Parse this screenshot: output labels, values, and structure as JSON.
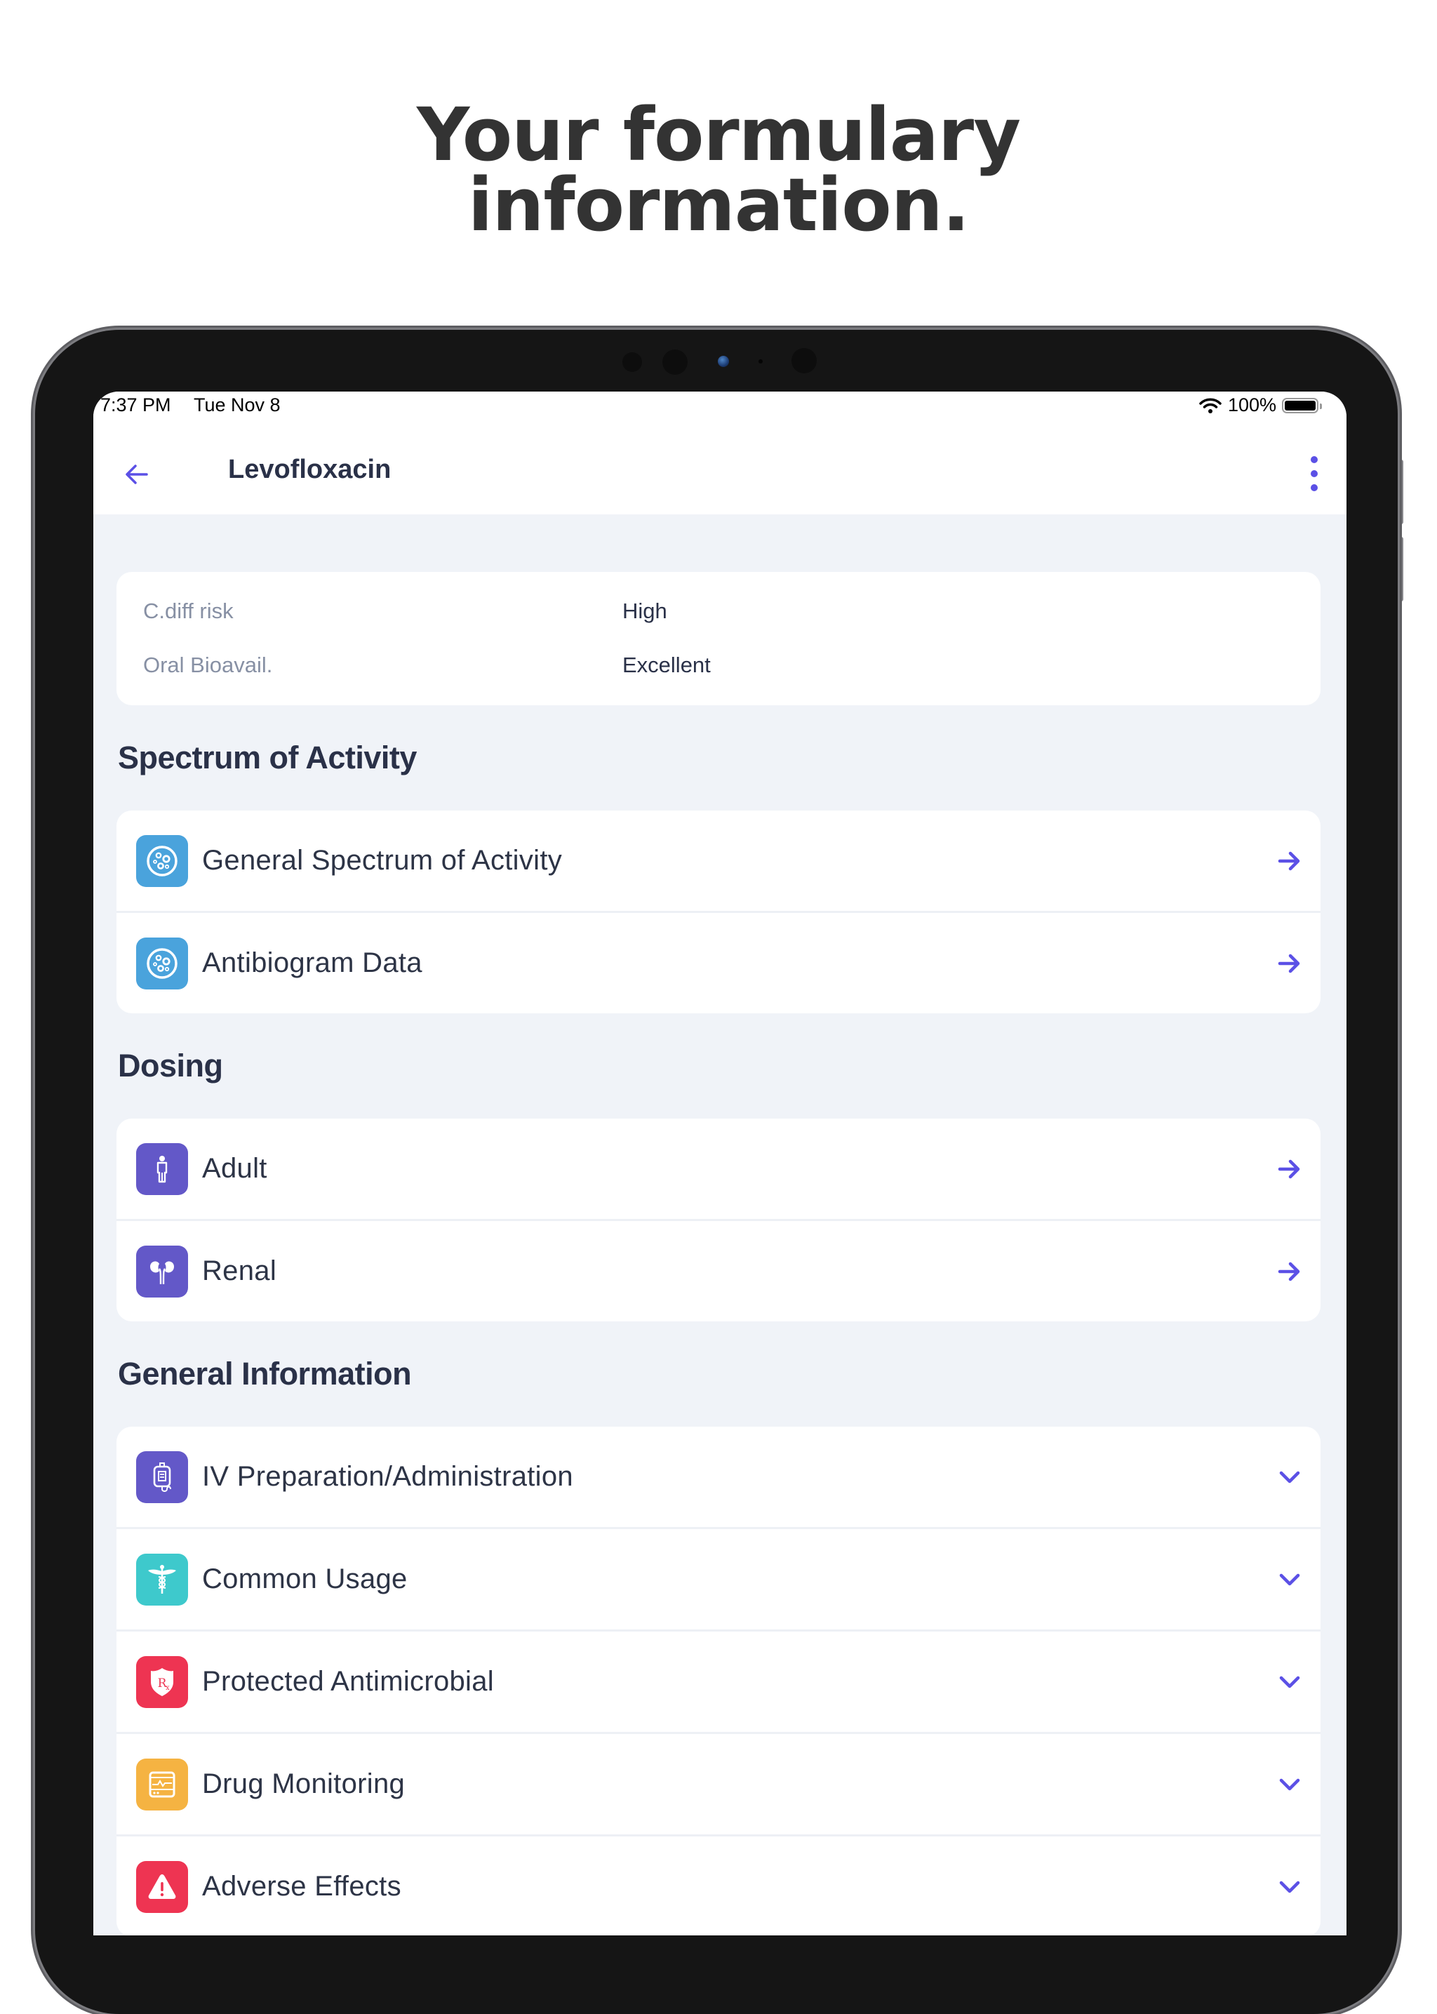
{
  "headline": {
    "line1": "Your formulary",
    "line2": "information."
  },
  "status_bar": {
    "time": "7:37 PM",
    "date": "Tue Nov 8",
    "battery_percent": "100%",
    "icons": [
      "wifi-icon",
      "battery-icon"
    ]
  },
  "nav": {
    "back_icon": "arrow-left-icon",
    "title": "Levofloxacin",
    "more_icon": "more-vertical-icon"
  },
  "info": [
    {
      "label": "C.diff risk",
      "value": "High"
    },
    {
      "label": "Oral Bioavail.",
      "value": "Excellent"
    }
  ],
  "sections": [
    {
      "title": "Spectrum of Activity",
      "items": [
        {
          "label": "General Spectrum of Activity",
          "icon": "petri-dish-icon",
          "icon_color": "#4aa3dc",
          "trail": "arrow-right-icon"
        },
        {
          "label": "Antibiogram Data",
          "icon": "petri-dish-icon",
          "icon_color": "#4aa3dc",
          "trail": "arrow-right-icon"
        }
      ]
    },
    {
      "title": "Dosing",
      "items": [
        {
          "label": "Adult",
          "icon": "person-icon",
          "icon_color": "#6358c8",
          "trail": "arrow-right-icon"
        },
        {
          "label": "Renal",
          "icon": "kidneys-icon",
          "icon_color": "#6358c8",
          "trail": "arrow-right-icon"
        }
      ]
    },
    {
      "title": "General Information",
      "items": [
        {
          "label": "IV Preparation/Administration",
          "icon": "iv-bag-icon",
          "icon_color": "#6358c8",
          "trail": "chevron-down-icon"
        },
        {
          "label": "Common Usage",
          "icon": "caduceus-icon",
          "icon_color": "#3ec9cc",
          "trail": "chevron-down-icon"
        },
        {
          "label": "Protected Antimicrobial",
          "icon": "rx-shield-icon",
          "icon_color": "#ee3452",
          "trail": "chevron-down-icon"
        },
        {
          "label": "Drug Monitoring",
          "icon": "monitor-icon",
          "icon_color": "#f5b342",
          "trail": "chevron-down-icon"
        },
        {
          "label": "Adverse Effects",
          "icon": "warning-icon",
          "icon_color": "#ee3452",
          "trail": "chevron-down-icon"
        }
      ]
    }
  ],
  "colors": {
    "accent": "#5b50e6",
    "text_primary": "#2a3148",
    "text_secondary": "#8790a4",
    "background": "#f0f3f8"
  }
}
